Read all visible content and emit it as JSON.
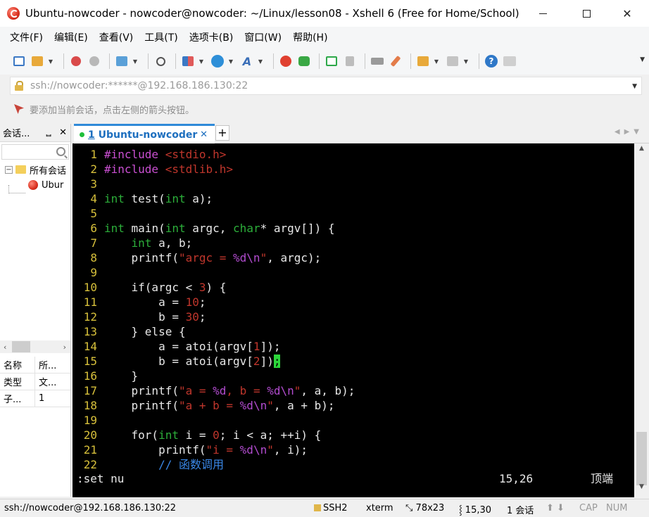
{
  "window": {
    "title": "Ubuntu-nowcoder - nowcoder@nowcoder: ~/Linux/lesson08 - Xshell 6 (Free for Home/School)"
  },
  "menu": [
    "文件(F)",
    "编辑(E)",
    "查看(V)",
    "工具(T)",
    "选项卡(B)",
    "窗口(W)",
    "帮助(H)"
  ],
  "address": {
    "value": "ssh://nowcoder:******@192.168.186.130:22"
  },
  "hint": {
    "text": "要添加当前会话，点击左侧的箭头按钮。"
  },
  "sessions": {
    "title": "会话...",
    "pin": "ᆸ",
    "close": "✕",
    "folder": "所有会话",
    "session": "Ubur",
    "properties": [
      {
        "key": "名称",
        "value": "所..."
      },
      {
        "key": "类型",
        "value": "文..."
      },
      {
        "key": "子...",
        "value": "1"
      }
    ]
  },
  "tab": {
    "number": "1",
    "label": "Ubuntu-nowcoder",
    "close": "✕",
    "add": "+"
  },
  "editor": {
    "status_cmd": ":set nu",
    "cursor_pos": "15,26",
    "scroll_loc": "顶端"
  },
  "statusbar": {
    "connection": "ssh://nowcoder@192.168.186.130:22",
    "protocol": "SSH2",
    "terminal": "xterm",
    "size": "78x23",
    "cursor": "15,30",
    "sessions": "1 会话",
    "caps": "CAP",
    "num": "NUM"
  },
  "colors": {
    "accent_tab": "#2f8ad8",
    "line_number": "#d7c03b",
    "preprocessor": "#c94fd1",
    "string": "#c0362c",
    "keyword": "#2cae3a",
    "comment": "#3a88e8"
  }
}
